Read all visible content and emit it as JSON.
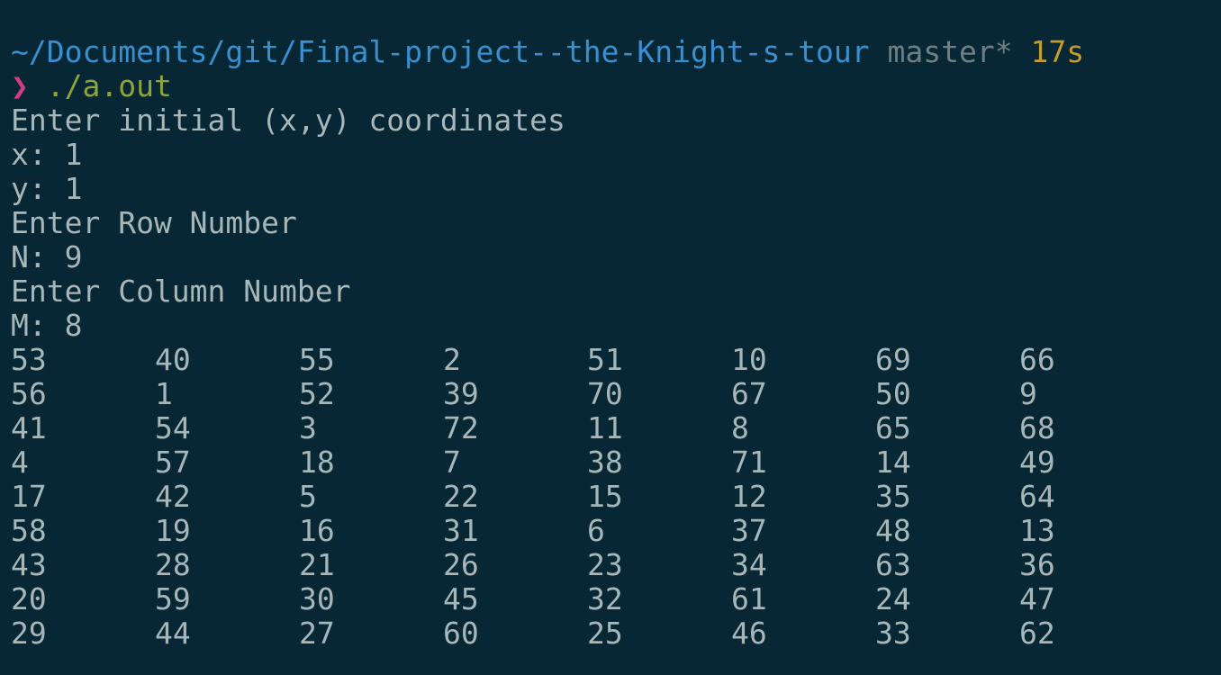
{
  "prompt": {
    "path": "~/Documents/git/Final-project--the-Knight-s-tour",
    "branch": "master*",
    "duration": "17s",
    "arrow": "❯",
    "command": "./a.out"
  },
  "output": {
    "coord_prompt": "Enter initial (x,y) coordinates",
    "x_line": "x: 1",
    "y_line": "y: 1",
    "row_prompt": "Enter Row Number",
    "n_line": "N: 9",
    "col_prompt": "Enter Column Number",
    "m_line": "M: 8"
  },
  "board": {
    "rows": [
      [
        "53",
        "40",
        "55",
        "2",
        "51",
        "10",
        "69",
        "66"
      ],
      [
        "56",
        "1",
        "52",
        "39",
        "70",
        "67",
        "50",
        "9"
      ],
      [
        "41",
        "54",
        "3",
        "72",
        "11",
        "8",
        "65",
        "68"
      ],
      [
        "4",
        "57",
        "18",
        "7",
        "38",
        "71",
        "14",
        "49"
      ],
      [
        "17",
        "42",
        "5",
        "22",
        "15",
        "12",
        "35",
        "64"
      ],
      [
        "58",
        "19",
        "16",
        "31",
        "6",
        "37",
        "48",
        "13"
      ],
      [
        "43",
        "28",
        "21",
        "26",
        "23",
        "34",
        "63",
        "36"
      ],
      [
        "20",
        "59",
        "30",
        "45",
        "32",
        "61",
        "24",
        "47"
      ],
      [
        "29",
        "44",
        "27",
        "60",
        "25",
        "46",
        "33",
        "62"
      ]
    ]
  },
  "colors": {
    "background": "#062733",
    "text": "#a7b6b9",
    "path": "#3a8fcf",
    "branch": "#6f7f83",
    "duration": "#c59b2e",
    "arrow": "#d23d80",
    "command": "#8ea33a"
  }
}
